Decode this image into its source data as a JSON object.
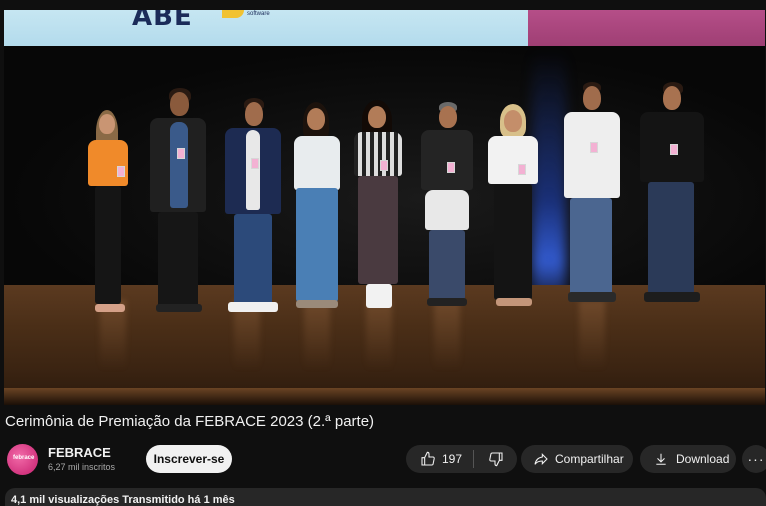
{
  "video": {
    "banner_logo": "ABE",
    "banner_software": "software",
    "title": "Cerimônia de Premiação da FEBRACE 2023 (2.ª parte)"
  },
  "channel": {
    "name": "FEBRACE",
    "subscribers": "6,27 mil inscritos",
    "avatar_text": "febrace",
    "subscribe_label": "Inscrever-se"
  },
  "actions": {
    "like_count": "197",
    "share_label": "Compartilhar",
    "download_label": "Download",
    "more_label": "···",
    "icons": {
      "like": "thumbs-up-icon",
      "dislike": "thumbs-down-icon",
      "share": "share-arrow-icon",
      "download": "download-icon",
      "more": "more-horizontal-icon"
    }
  },
  "description": {
    "meta": "4,1 mil visualizações  Transmitido há 1 mês"
  },
  "colors": {
    "background": "#0f0f0f",
    "button_bg": "#272727",
    "subscribe_bg": "#f1f1f1",
    "channel_accent": "#d3357f"
  }
}
